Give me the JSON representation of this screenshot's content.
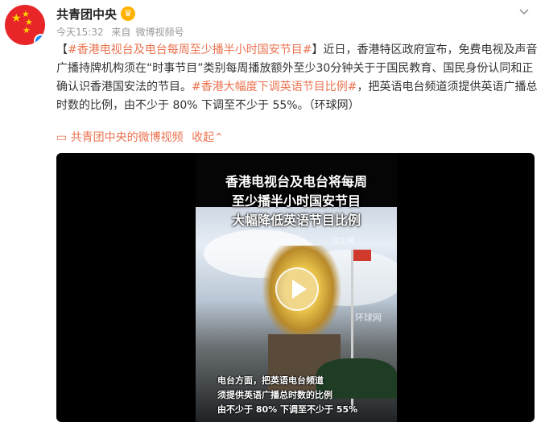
{
  "post": {
    "author": "共青团中央",
    "time": "今天15:32",
    "source_prefix": "来自",
    "source": "微博视频号",
    "topic1": "#香港电视台及电台每周至少播半小时国安节目#",
    "body1_bracket_open": "【",
    "body1_bracket_close": "】",
    "body1": "近日，香港特区政府宣布，免费电视及声音广播持牌机构须在“时事节目”类别每周播放额外至少30分钟关于于国民教育、国民身份认同和正确认识香港国安法的节目。",
    "topic2": "#香港大幅度下调英语节目比例#",
    "body2": "，把英语电台频道须提供英语广播总时数的比例，由不少于 80% 下调至不少于 55%。（环球网）",
    "video_link_label": "共青团中央的微博视频",
    "collapse_label": "收起"
  },
  "video": {
    "title_line1": "香港电视台及电台将每周",
    "title_line2": "至少播半小时国安节目",
    "title_line3": "大幅降低英语节目比例",
    "watermark_top": "文汇网",
    "watermark_mid": "环球网",
    "subtitle_line1": "电台方面，把英语电台频道",
    "subtitle_line2": "须提供英语广播总时数的比例",
    "subtitle_line3": "由不少于 80% 下调至不少于 55%"
  },
  "icons": {
    "crown": "crown-icon",
    "chevron": "chevron-down-icon",
    "video_link": "video-icon",
    "play": "play-icon",
    "verified": "verified-badge-icon"
  },
  "colors": {
    "accent": "#eb7350",
    "avatar_bg": "#e8262a"
  }
}
